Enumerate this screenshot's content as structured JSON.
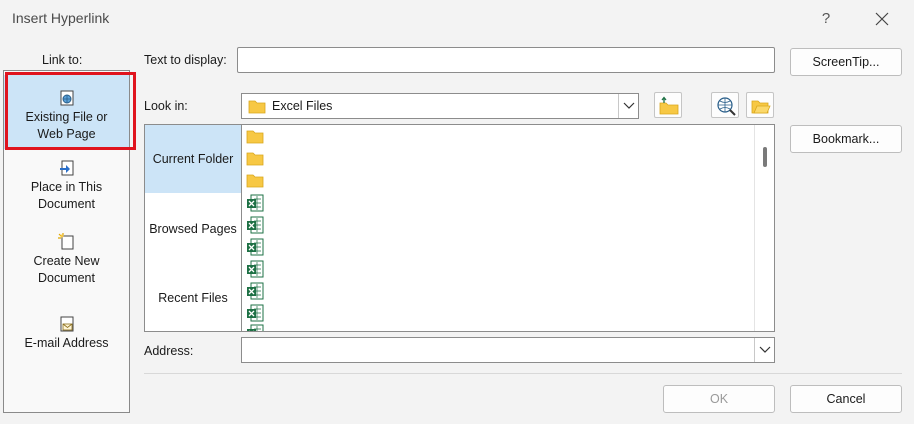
{
  "window": {
    "title": "Insert Hyperlink",
    "help_label": "?"
  },
  "link_to": {
    "label": "Link to:",
    "items": [
      {
        "line1": "Existing File or",
        "line2": "Web Page",
        "icon": "existing-file-icon",
        "selected": true
      },
      {
        "line1": "Place in This",
        "line2": "Document",
        "icon": "place-in-document-icon",
        "selected": false
      },
      {
        "line1": "Create New",
        "line2": "Document",
        "icon": "create-new-document-icon",
        "selected": false
      },
      {
        "line1": "E-mail Address",
        "icon": "email-address-icon",
        "selected": false
      }
    ]
  },
  "text_to_display": {
    "label": "Text to display:",
    "value": ""
  },
  "screentip_label": "ScreenTip...",
  "look_in": {
    "label": "Look in:",
    "value": "Excel Files"
  },
  "toolbar": {
    "up_folder_icon": "up-one-folder-icon",
    "browse_web_icon": "browse-web-icon",
    "browse_file_icon": "browse-file-icon"
  },
  "bookmark_label": "Bookmark...",
  "left_list": {
    "items": [
      {
        "label": "Current Folder",
        "selected": true
      },
      {
        "label": "Browsed Pages",
        "selected": false
      },
      {
        "label": "Recent Files",
        "selected": false
      }
    ]
  },
  "files": {
    "folders": 3,
    "excel_files": 7
  },
  "address": {
    "label": "Address:",
    "value": ""
  },
  "buttons": {
    "ok": "OK",
    "cancel": "Cancel"
  },
  "colors": {
    "selection": "#cce4f7",
    "highlight_box": "#e0141e",
    "folder": "#f7c844",
    "excel": "#1e7145"
  }
}
